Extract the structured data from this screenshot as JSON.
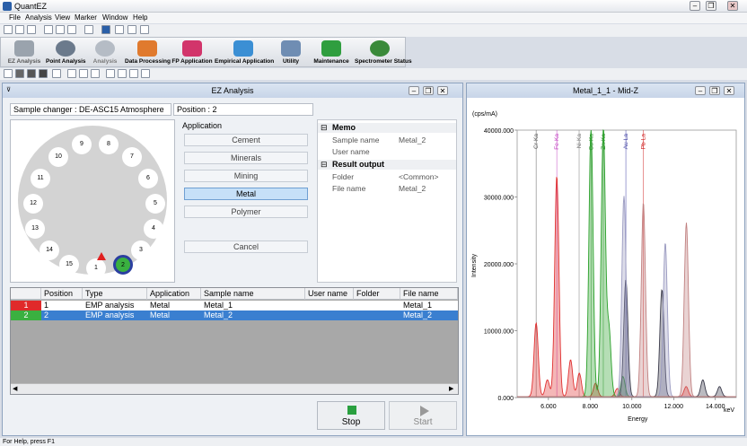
{
  "app": {
    "title": "QuantEZ"
  },
  "menu": [
    "File",
    "Analysis",
    "View",
    "Marker",
    "Window",
    "Help"
  ],
  "ribbon": [
    {
      "label": "EZ Analysis",
      "color": "#9aa3ad"
    },
    {
      "label": "Point Analysis",
      "color": "#6b7a8c"
    },
    {
      "label": "Analysis",
      "color": "#b5bcc5"
    },
    {
      "label": "Data Processing",
      "color": "#e07a2e"
    },
    {
      "label": "FP Application",
      "color": "#d2356b"
    },
    {
      "label": "Empirical Application",
      "color": "#3b8fd4"
    },
    {
      "label": "Utility",
      "color": "#6f8db3"
    },
    {
      "label": "Maintenance",
      "color": "#2f9e3f"
    },
    {
      "label": "Spectrometer Status",
      "color": "#3a8a3a"
    }
  ],
  "ez": {
    "title": "EZ Analysis",
    "sample_changer": "Sample changer : DE-ASC15  Atmosphere",
    "position": "Position : 2",
    "slots": [
      "9",
      "8",
      "10",
      "7",
      "11",
      "6",
      "12",
      "5",
      "13",
      "4",
      "14",
      "3",
      "15",
      "1",
      "2"
    ],
    "application_heading": "Application",
    "applications": [
      "Cement",
      "Minerals",
      "Mining",
      "Metal",
      "Polymer"
    ],
    "cancel": "Cancel",
    "memo": {
      "group": "Memo",
      "rows": [
        {
          "k": "Sample name",
          "v": "Metal_2"
        },
        {
          "k": "User name",
          "v": ""
        }
      ]
    },
    "result": {
      "group": "Result output",
      "rows": [
        {
          "k": "Folder",
          "v": "<Common>"
        },
        {
          "k": "File name",
          "v": "Metal_2"
        }
      ]
    },
    "grid": {
      "headers": [
        "",
        "Position",
        "Type",
        "Application",
        "Sample name",
        "User name",
        "Folder",
        "File name"
      ],
      "rows": [
        {
          "no": "1",
          "position": "1",
          "type": "EMP analysis",
          "application": "Metal",
          "sample": "Metal_1",
          "user": "",
          "folder": "",
          "file": "Metal_1"
        },
        {
          "no": "2",
          "position": "2",
          "type": "EMP analysis",
          "application": "Metal",
          "sample": "Metal_2",
          "user": "",
          "folder": "",
          "file": "Metal_2"
        }
      ]
    },
    "stop": "Stop",
    "start": "Start"
  },
  "spectrum": {
    "title": "Metal_1_1 - Mid-Z",
    "chart_data": {
      "type": "line",
      "yunit": "(cps/mA)",
      "ylabel": "Intensity",
      "xlabel": "Energy",
      "xunit": "keV",
      "yticks": [
        "40000.000",
        "30000.000",
        "20000.000",
        "10000.000",
        "0.000"
      ],
      "xticks": [
        "6.000",
        "8.000",
        "10.000",
        "12.000",
        "14.000"
      ],
      "xlim": [
        4.5,
        15
      ],
      "ylim": [
        0,
        40000
      ],
      "markers": [
        {
          "label": "Cr-Ka",
          "x": 5.41,
          "color": "#555555"
        },
        {
          "label": "Fe-Ka",
          "x": 6.4,
          "color": "#c03cc0"
        },
        {
          "label": "Ni-Ka",
          "x": 7.47,
          "color": "#777777"
        },
        {
          "label": "Cu-Ka",
          "x": 8.04,
          "color": "#2a8a2a"
        },
        {
          "label": "Zn-Ka",
          "x": 8.63,
          "color": "#2a8a2a"
        },
        {
          "label": "Au-La",
          "x": 9.71,
          "color": "#3a3aa0"
        },
        {
          "label": "Pb-La",
          "x": 10.55,
          "color": "#d02020"
        }
      ],
      "series": [
        {
          "color": "#e03030",
          "peaks": [
            [
              5.41,
              11000
            ],
            [
              5.95,
              2500
            ],
            [
              6.4,
              33000
            ],
            [
              7.06,
              5500
            ],
            [
              7.48,
              3500
            ],
            [
              8.26,
              2000
            ],
            [
              9.3,
              1200
            ],
            [
              12.6,
              1500
            ]
          ]
        },
        {
          "color": "#2aa02a",
          "peaks": [
            [
              8.04,
              40000
            ],
            [
              8.63,
              40000
            ],
            [
              8.9,
              10000
            ],
            [
              9.57,
              3000
            ]
          ]
        },
        {
          "color": "#3a3a4a",
          "peaks": [
            [
              9.71,
              17500
            ],
            [
              11.44,
              16000
            ],
            [
              13.4,
              2500
            ],
            [
              14.2,
              1500
            ]
          ]
        },
        {
          "color": "#9a9ac0",
          "peaks": [
            [
              9.62,
              30000
            ],
            [
              11.6,
              23000
            ]
          ]
        },
        {
          "color": "#c08080",
          "peaks": [
            [
              10.55,
              29000
            ],
            [
              12.61,
              26000
            ]
          ]
        }
      ]
    }
  },
  "status": "For Help, press F1"
}
